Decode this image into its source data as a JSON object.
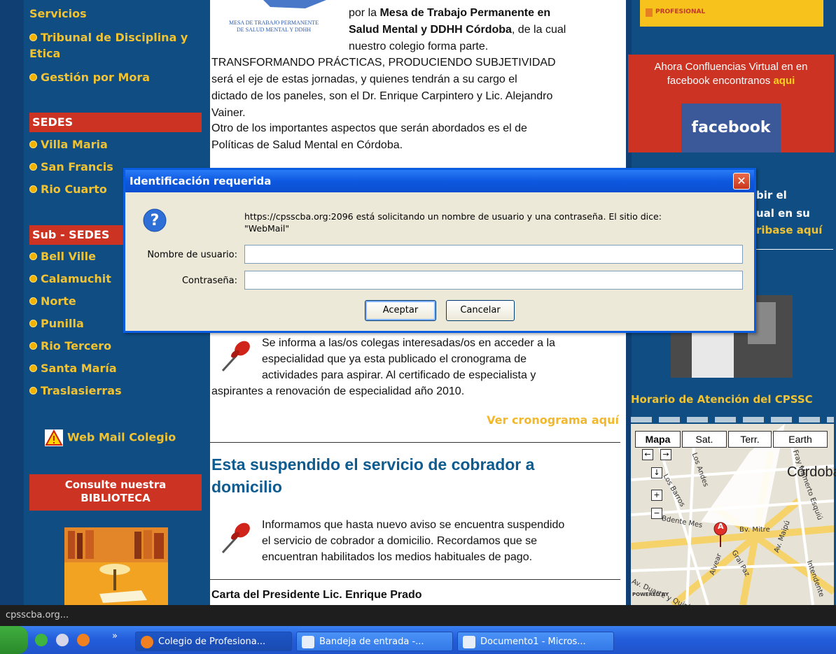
{
  "left_nav": {
    "top_items": [
      "Servicios",
      "Tribunal de Disciplina y Etica",
      "Gestión por Mora"
    ],
    "tribunal_line1": "Tribunal de Disciplina y",
    "tribunal_line2": "Etica",
    "sedes_header": "SEDES",
    "sedes": [
      "Villa Maria",
      "San Francis",
      "Rio Cuarto"
    ],
    "subsedes_header": "Sub - SEDES",
    "subsedes": [
      "Bell Ville",
      "Calamuchit",
      "Norte",
      "Punilla",
      "Rio Tercero",
      "Santa María",
      "Traslasierras"
    ],
    "webmail": "Web Mail Colegio",
    "biblioteca_line1": "Consulte nuestra",
    "biblioteca_line2": "BIBLIOTECA"
  },
  "middle": {
    "logo_line1": "MESA DE TRABAJO PERMANENTE",
    "logo_line2": "DE SALUD MENTAL Y DDHH",
    "intro_a": "por la ",
    "intro_b": "Mesa de Trabajo Permanente en",
    "intro_c": "Salud Mental y DDHH Córdoba",
    "intro_d": ", de la cual",
    "intro_e": "nuestro colegio forma parte.",
    "p1_line1": "TRANSFORMANDO PRÁCTICAS, PRODUCIENDO SUBJETIVIDAD",
    "p1_line2": "será el eje de estas jornadas, y quienes tendrán a su cargo el",
    "p1_line3": "dictado de los paneles, son el Dr. Enrique Carpintero y Lic. Alejandro",
    "p1_line4": "Vainer.",
    "p2_line1": "Otro de los importantes aspectos que serán abordados es el de",
    "p2_line2": "Políticas de Salud Mental en Córdoba.",
    "esp_line1": "Se informa a las/os colegas interesadas/os en acceder a la",
    "esp_line2": "especialidad que ya esta publicado el cronograma de",
    "esp_line3": "actividades para aspirar. Al certificado de especialista y",
    "esp_line4": "aspirantes a renovación de especialidad año 2010.",
    "cronograma_link": "Ver cronograma aquí",
    "headline_line1": "Esta suspendido el servicio de cobrador a",
    "headline_line2": "domicilio",
    "cob_line1": "Informamos que hasta nuevo aviso se encuentra suspendido",
    "cob_line2": "el servicio de cobrador a domicilio. Recordamos que se",
    "cob_line3": "encuentran habilitados los medios habituales de pago.",
    "carta": "Carta del Presidente Lic. Enrique Prado"
  },
  "right": {
    "banner_text": "PROFESIONAL",
    "fb_line1": "Ahora Confluencias Virtual en en",
    "fb_line2a": "facebook encontranos ",
    "fb_line2b": "aqui",
    "fb_button": "facebook",
    "partial1": "bir el",
    "partial2": "ual en su",
    "partial3": "ribase aquí",
    "horario": "Horario de Atención del CPSSC",
    "map_tabs": [
      "Mapa",
      "Sat.",
      "Terr.",
      "Earth"
    ],
    "map_city": "Córdoba",
    "map_streets": [
      "Bv. Mitre",
      "Fray Mamerto Esquiú",
      "Gral Paz",
      "Av. Maipú",
      "Intendente",
      "Av. Duarte y Quirós",
      "Alvear",
      "Los Andes",
      "Los Barros",
      "Bdente Mes"
    ],
    "map_marker": "A",
    "map_powered": "POWERED BY"
  },
  "dialog": {
    "title": "Identificación requerida",
    "close": "✕",
    "message_line1": "https://cpsscba.org:2096 está solicitando un nombre de usuario y una contraseña. El sitio dice:",
    "message_line2": "\"WebMail\"",
    "username_label": "Nombre de usuario:",
    "password_label": "Contraseña:",
    "username_value": "",
    "password_value": "",
    "ok": "Aceptar",
    "cancel": "Cancelar"
  },
  "status_bar": {
    "text": "cpsscba.org..."
  },
  "taskbar": {
    "buttons": [
      "Colegio de Profesiona...",
      "Bandeja de entrada -...",
      "Documento1 - Micros..."
    ],
    "chevron": "»"
  },
  "colors": {
    "sidebar_blue": "#104d82",
    "link_yellow": "#f1c231",
    "header_red": "#cc3322",
    "headline_blue": "#0d5b8f",
    "dialog_title": "#0d58e0",
    "facebook": "#3b5998"
  }
}
